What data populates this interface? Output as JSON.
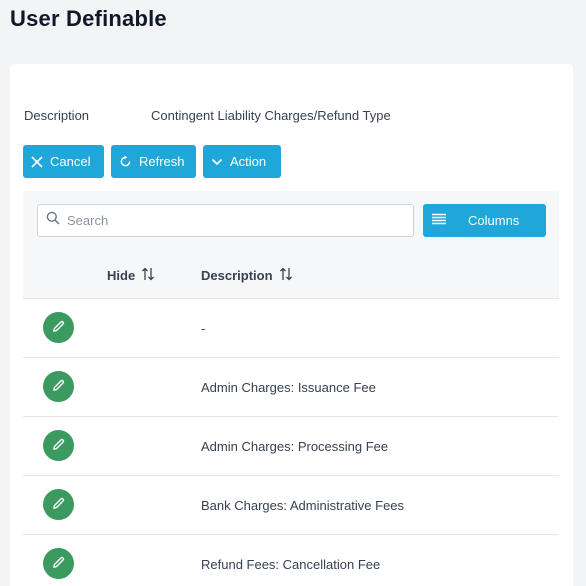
{
  "page": {
    "title": "User Definable"
  },
  "details": {
    "description_label": "Description",
    "description_value": "Contingent Liability Charges/Refund Type"
  },
  "toolbar": {
    "cancel_label": "Cancel",
    "refresh_label": "Refresh",
    "action_label": "Action",
    "cancel_icon": "close-icon",
    "refresh_icon": "refresh-icon",
    "action_icon": "chevron-down-icon"
  },
  "search": {
    "placeholder": "Search",
    "value": ""
  },
  "columns_button": {
    "label": "Columns",
    "icon": "list-icon"
  },
  "table": {
    "headers": {
      "hide": "Hide",
      "description": "Description"
    },
    "rows": [
      {
        "description": "-"
      },
      {
        "description": "Admin Charges: Issuance Fee"
      },
      {
        "description": "Admin Charges: Processing Fee"
      },
      {
        "description": "Bank Charges: Administrative Fees"
      },
      {
        "description": "Refund Fees: Cancellation Fee"
      }
    ]
  },
  "colors": {
    "accent": "#1ea7d8",
    "edit_button": "#3a9a5f",
    "background": "#f3f4f6",
    "card": "#ffffff"
  }
}
